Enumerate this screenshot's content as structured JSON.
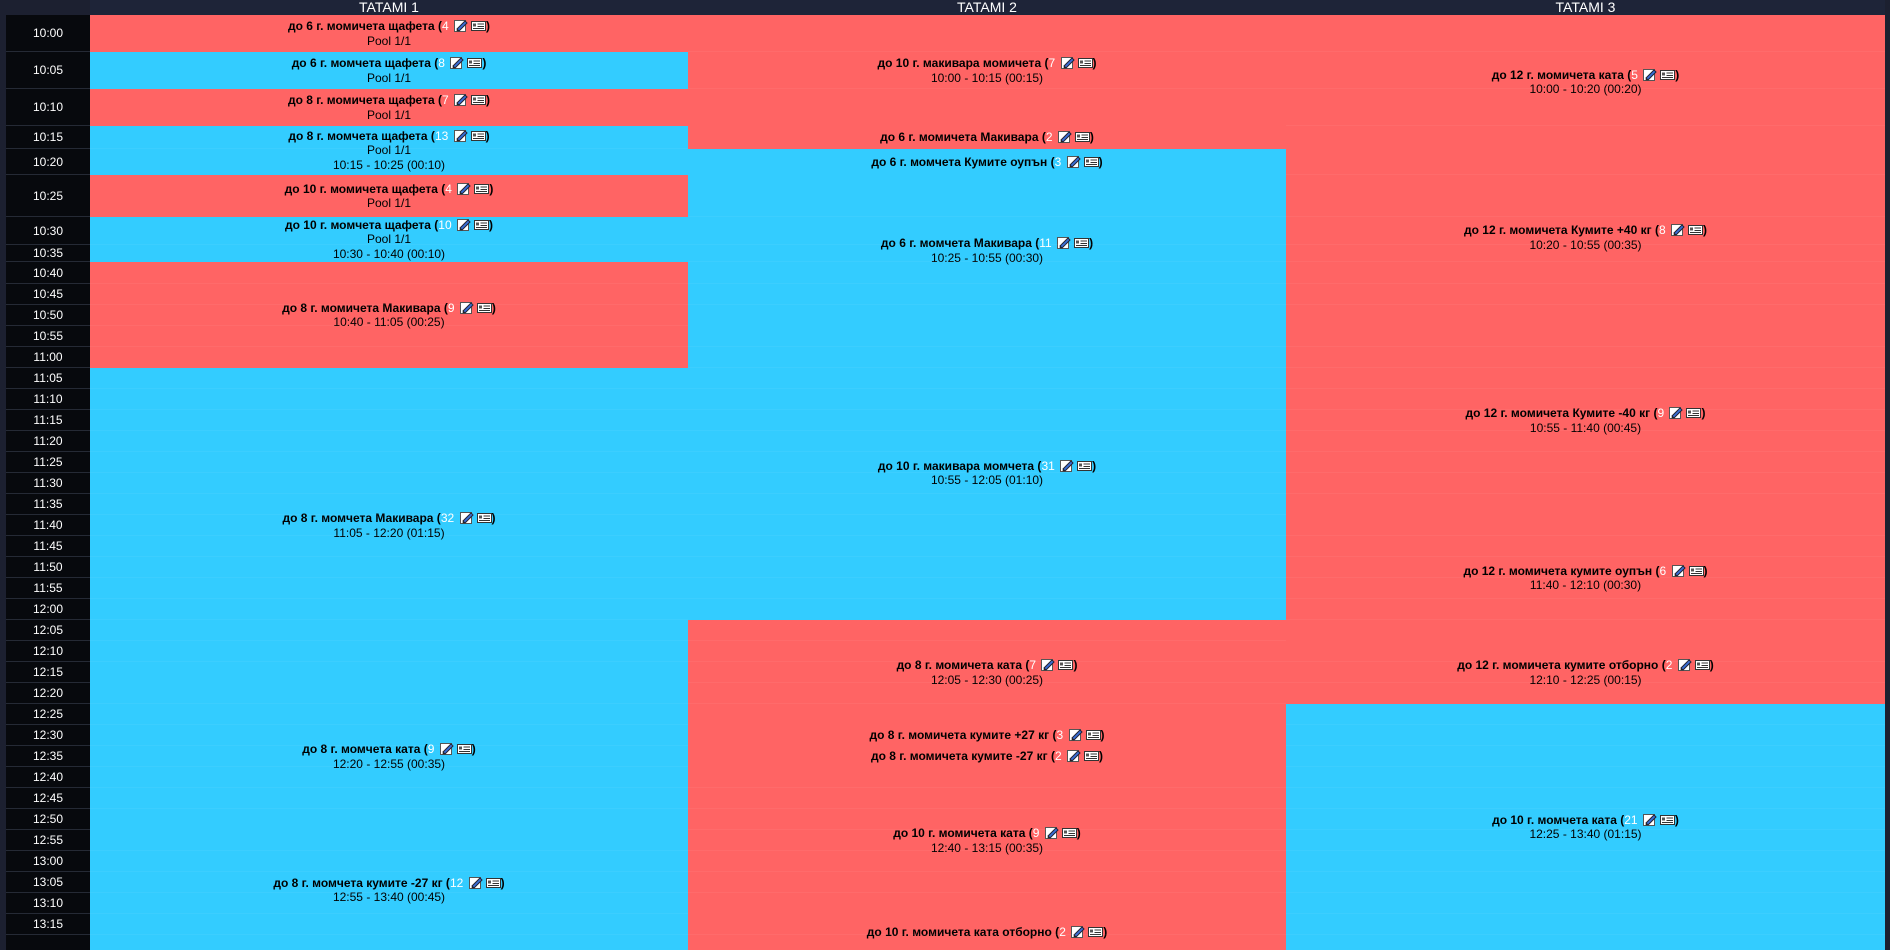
{
  "headers": [
    "TATAMI 1",
    "TATAMI 2",
    "TATAMI 3"
  ],
  "times": [
    "10:00",
    "10:05",
    "10:10",
    "10:15",
    "10:20",
    "10:25",
    "10:30",
    "10:35",
    "10:40",
    "10:45",
    "10:50",
    "10:55",
    "11:00",
    "11:05",
    "11:10",
    "11:15",
    "11:20",
    "11:25",
    "11:30",
    "11:35",
    "11:40",
    "11:45",
    "11:50",
    "11:55",
    "12:00",
    "12:05",
    "12:10",
    "12:15",
    "12:20",
    "12:25",
    "12:30",
    "12:35",
    "12:40",
    "12:45",
    "12:50",
    "12:55",
    "13:00",
    "13:05",
    "13:10",
    "13:15"
  ],
  "colors": {
    "red": "#ff6464",
    "blue": "#33ccff"
  },
  "icons": [
    "edit-icon",
    "card-icon"
  ],
  "tatami": [
    [
      {
        "title": "до 6 г. момичета щафета",
        "count": "4",
        "sub": [
          "Pool 1/1"
        ],
        "color": "red"
      },
      {
        "title": "до 6 г. момчета щафета",
        "count": "8",
        "sub": [
          "Pool 1/1"
        ],
        "color": "blue"
      },
      {
        "title": "до 8 г. момичета щафета",
        "count": "7",
        "sub": [
          "Pool 1/1"
        ],
        "color": "red"
      },
      {
        "title": "до 8 г. момчета щафета",
        "count": "13",
        "sub": [
          "Pool 1/1",
          "10:15 - 10:25 (00:10)"
        ],
        "color": "blue"
      },
      {
        "title": "до 10 г. момичета щафета",
        "count": "4",
        "sub": [
          "Pool 1/1"
        ],
        "color": "red"
      },
      {
        "title": "до 10 г. момчета щафета",
        "count": "10",
        "sub": [
          "Pool 1/1",
          "10:30 - 10:40 (00:10)"
        ],
        "color": "blue"
      },
      {
        "title": "до 8 г. момичета Макивара",
        "count": "9",
        "sub": [
          "10:40 - 11:05 (00:25)"
        ],
        "color": "red"
      },
      {
        "title": "до 8 г. момчета Макивара",
        "count": "32",
        "sub": [
          "11:05 - 12:20 (01:15)"
        ],
        "color": "blue"
      },
      {
        "title": "до 8 г. момчета ката",
        "count": "9",
        "sub": [
          "12:20 - 12:55 (00:35)"
        ],
        "color": "blue"
      },
      {
        "title": "до 8 г. момчета кумите -27 кг",
        "count": "12",
        "sub": [
          "12:55 - 13:40 (00:45)"
        ],
        "color": "blue"
      }
    ],
    [
      {
        "title": "до 10 г. макивара момичета",
        "count": "7",
        "sub": [
          "10:00 - 10:15 (00:15)"
        ],
        "color": "red"
      },
      {
        "title": "до 6 г. момичета Макивара",
        "count": "2",
        "sub": [],
        "color": "red"
      },
      {
        "title": "до 6 г. момчета Кумите оупън",
        "count": "3",
        "sub": [],
        "color": "blue"
      },
      {
        "title": "до 6 г. момчета Макивара",
        "count": "11",
        "sub": [
          "10:25 - 10:55 (00:30)"
        ],
        "color": "blue"
      },
      {
        "title": "до 10 г. макивара момчета",
        "count": "31",
        "sub": [
          "10:55 - 12:05 (01:10)"
        ],
        "color": "blue"
      },
      {
        "title": "до 8 г. момичета ката",
        "count": "7",
        "sub": [
          "12:05 - 12:30 (00:25)"
        ],
        "color": "red"
      },
      {
        "title": "до 8 г. момичета кумите +27 кг",
        "count": "3",
        "sub": [],
        "color": "red"
      },
      {
        "title": "до 8 г. момичета кумите -27 кг",
        "count": "2",
        "sub": [],
        "color": "red"
      },
      {
        "title": "до 10 г. момичета ката",
        "count": "9",
        "sub": [
          "12:40 - 13:15 (00:35)"
        ],
        "color": "red"
      },
      {
        "title": "до 10 г. момичета ката отборно",
        "count": "2",
        "sub": [],
        "color": "red"
      }
    ],
    [
      {
        "title": "до 12 г. момичета ката",
        "count": "5",
        "sub": [
          "10:00 - 10:20 (00:20)"
        ],
        "color": "red"
      },
      {
        "title": "до 12 г. момичета Кумите +40 кг",
        "count": "8",
        "sub": [
          "10:20 - 10:55 (00:35)"
        ],
        "color": "red"
      },
      {
        "title": "до 12 г. момичета Кумите -40 кг",
        "count": "9",
        "sub": [
          "10:55 - 11:40 (00:45)"
        ],
        "color": "red"
      },
      {
        "title": "до 12 г. момичета кумите оупън",
        "count": "6",
        "sub": [
          "11:40 - 12:10 (00:30)"
        ],
        "color": "red"
      },
      {
        "title": "до 12 г. момичета кумите отборно",
        "count": "2",
        "sub": [
          "12:10 - 12:25 (00:15)"
        ],
        "color": "red"
      },
      {
        "title": "до 10 г. момчета ката",
        "count": "21",
        "sub": [
          "12:25 - 13:40 (01:15)"
        ],
        "color": "blue"
      }
    ]
  ]
}
